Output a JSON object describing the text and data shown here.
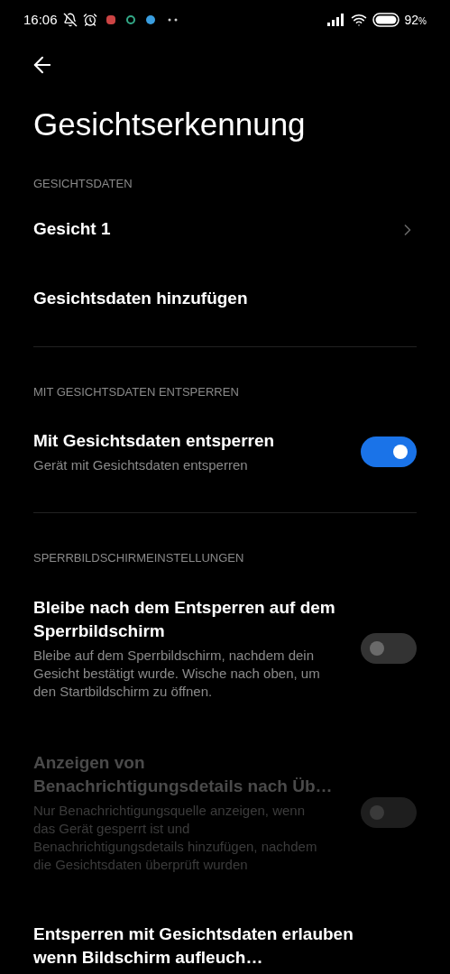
{
  "status_bar": {
    "time": "16:06",
    "battery": "92",
    "battery_unit": "%"
  },
  "title": "Gesichtserkennung",
  "sections": [
    {
      "header": "GESICHTSDATEN",
      "items": [
        {
          "kind": "link",
          "title": "Gesicht 1"
        },
        {
          "kind": "action",
          "title": "Gesichtsdaten hinzufügen"
        }
      ]
    },
    {
      "header": "MIT GESICHTSDATEN ENTSPERREN",
      "items": [
        {
          "kind": "toggle",
          "title": "Mit Gesichtsdaten entsperren",
          "subtitle": "Gerät mit Gesichtsdaten entsperren",
          "on": true,
          "disabled": false
        }
      ]
    },
    {
      "header": "SPERRBILDSCHIRMEINSTELLUNGEN",
      "items": [
        {
          "kind": "toggle",
          "title": "Bleibe nach dem Entsperren auf dem Sperrbildschirm",
          "subtitle": "Bleibe auf dem Sperrbildschirm, nachdem dein Gesicht bestätigt wurde. Wische nach oben, um den Startbildschirm zu öffnen.",
          "on": false,
          "disabled": false
        },
        {
          "kind": "toggle",
          "title": "Anzeigen von Benachrichtigungsdetails nach Üb…",
          "subtitle": "Nur Benachrichtigungsquelle anzeigen, wenn das Gerät gesperrt ist und Benachrichtigungsdetails hinzufügen, nachdem die Gesichtsdaten überprüft wurden",
          "on": false,
          "disabled": true
        },
        {
          "kind": "action",
          "title": "Entsperren mit Gesichtsdaten erlauben wenn Bildschirm aufleuch…"
        }
      ]
    }
  ]
}
